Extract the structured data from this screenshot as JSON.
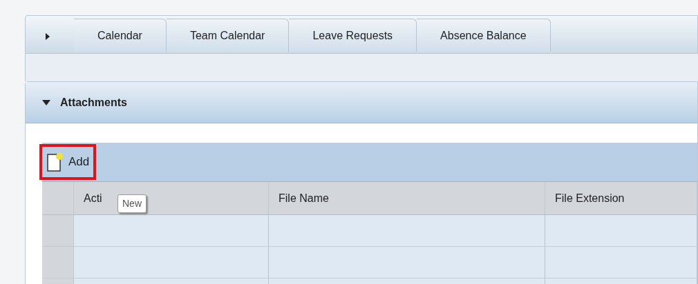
{
  "tabs": [
    {
      "label": "Calendar"
    },
    {
      "label": "Team Calendar"
    },
    {
      "label": "Leave Requests"
    },
    {
      "label": "Absence Balance"
    }
  ],
  "panel": {
    "title": "Attachments",
    "expanded": true
  },
  "toolbar": {
    "add_button": {
      "label": "Add",
      "highlighted": true
    }
  },
  "tooltip": {
    "text": "New"
  },
  "table": {
    "columns": [
      "Acti",
      "File Name",
      "File Extension"
    ]
  }
}
